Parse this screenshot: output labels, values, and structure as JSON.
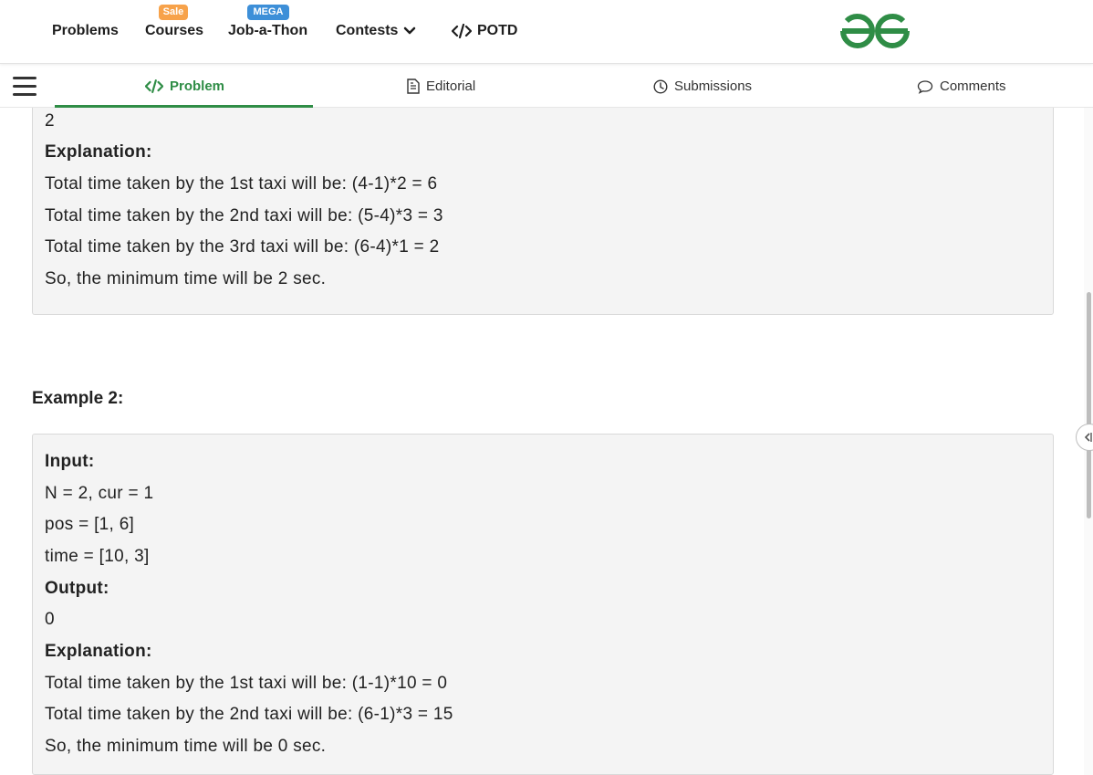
{
  "nav": {
    "problems": "Problems",
    "courses": "Courses",
    "courses_badge": "Sale",
    "job": "Job-a-Thon",
    "job_badge": "MEGA",
    "contests": "Contests",
    "potd": "POTD"
  },
  "tabs": {
    "problem": "Problem",
    "editorial": "Editorial",
    "submissions": "Submissions",
    "comments": "Comments"
  },
  "example1": {
    "output_value": "2",
    "explanation_label": "Explanation:",
    "lines": [
      "Total time taken by the 1st taxi will be: (4-1)*2 = 6",
      "Total time taken by the 2nd taxi will be: (5-4)*3 = 3",
      "Total time taken by the 3rd taxi will be: (6-4)*1 = 2",
      "So, the minimum time will be 2 sec."
    ]
  },
  "example2": {
    "heading": "Example 2:",
    "input_label": "Input:",
    "input_lines": [
      "N = 2, cur = 1",
      "pos = [1, 6]",
      "time = [10, 3]"
    ],
    "output_label": "Output:",
    "output_value": "0",
    "explanation_label": "Explanation:",
    "lines": [
      "Total time taken by the 1st taxi will be: (1-1)*10 = 0",
      "Total time taken by the 2nd taxi will be: (6-1)*3 = 15",
      "So, the minimum time will be 0 sec."
    ]
  },
  "colors": {
    "brand_green": "#2f8d46",
    "sale_badge": "#f7a24a",
    "mega_badge": "#3d8fd8"
  }
}
